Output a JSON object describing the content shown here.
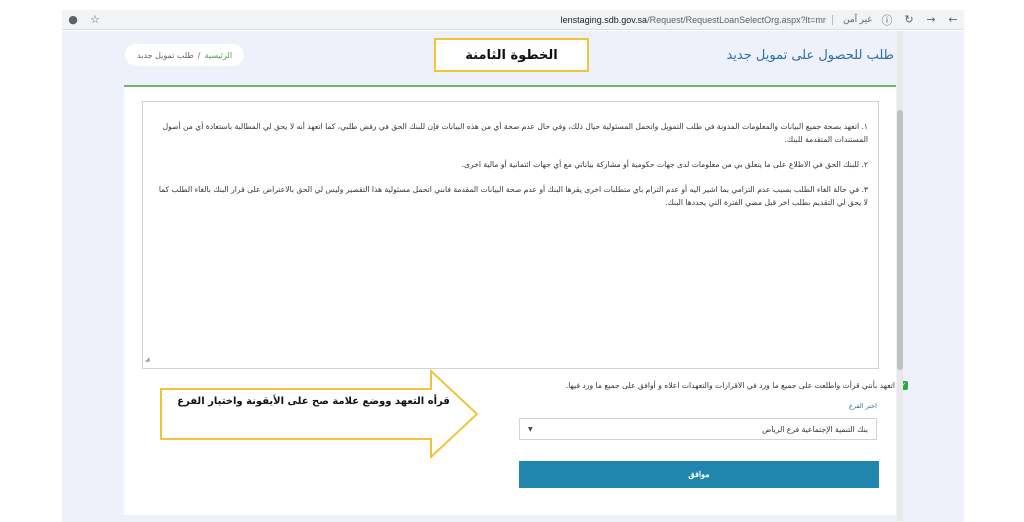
{
  "browser": {
    "url_host": "lenstaging.sdb.gov.sa",
    "url_path": "/Request/RequestLoanSelectOrg.aspx?lt=mr",
    "secure_label": "غير آمن"
  },
  "header": {
    "page_title": "طلب للحصول على تمويل جديد",
    "breadcrumb_home": "الرئيسية",
    "breadcrumb_sep": "/",
    "breadcrumb_current": "طلب تمويل جديد"
  },
  "annotation": {
    "step_label": "الخطوة الثامنة",
    "arrow_text": "قرأه التعهد ووضع علامة صح على الأيقونة واختيار الفرع"
  },
  "terms": {
    "p1": "١. اتعهد بصحة جميع البيانات والمعلومات المدونة في طلب التمويل واتحمل المسئولية حيال ذلك، وفي حال عدم صحة أي من هذه البيانات فإن للبنك الحق في رفض طلبي، كما اتعهد أنه لا يحق لي المطالبة باستعادة أي من أصول المستندات المتقدمة للبنك.",
    "p2": "٢. للبنك الحق في الاطلاع على ما يتعلق بي من معلومات لدى جهات حكومية أو مشاركة بياناتي مع أي جهات ائتمانية أو مالية اخرى.",
    "p3": "٣. في حالة الغاء الطلب بسبب عدم التزامي بما اشير اليه أو عدم التزام باي متطلبات اخرى يقرها البنك أو عدم صحة البيانات المقدمة فانني اتحمل مسئولية هذا التقصير وليس لي الحق بالاعتراض على قرار البنك بالغاء الطلب كما لا يحق لي التقديم بطلب اخر قبل مضي الفترة التي يحددها البنك."
  },
  "form": {
    "agree_text": "اتعهد بأنني قرأت واطلعت على جميع ما ورد في الاقرارات والتعهدات اعلاه و أوافق على جميع ما ورد فيها.",
    "branch_label": "اختر الفرع",
    "branch_selected": "بنك التنمية الإجتماعية فرع الرياض",
    "submit_label": "موافق"
  },
  "colors": {
    "accent": "#2086ad",
    "success": "#28a745",
    "highlight": "#f0c53a"
  }
}
